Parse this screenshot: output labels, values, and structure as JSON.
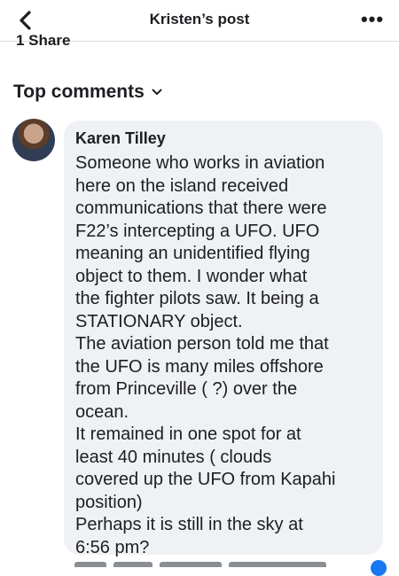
{
  "header": {
    "title": "Kristen’s post",
    "back_icon": "chevron-left-icon",
    "more_label": "•••"
  },
  "post": {
    "shares": "1 Share"
  },
  "comments_section": {
    "sort_label": "Top comments",
    "sort_icon": "chevron-down-icon"
  },
  "comment": {
    "author": "Karen Tilley",
    "text": "Someone who works in aviation\nhere on the island received\ncommunications that there were\nF22’s intercepting a UFO.   UFO\nmeaning an unidentified flying\nobject to them.  I wonder what\nthe fighter pilots saw. It being a\nSTATIONARY object.\nThe aviation person told me that\nthe UFO is many miles offshore\nfrom Princeville ( ?) over the\nocean.\nIt remained in one spot for at\nleast 40 minutes ( clouds\ncovered up the UFO from Kapahi\nposition)\nPerhaps it is still in the sky at\n6:56 pm?"
  },
  "colors": {
    "bubble_bg": "#eff1f4",
    "text": "#1c1e21",
    "reaction_blue": "#1877f2"
  }
}
